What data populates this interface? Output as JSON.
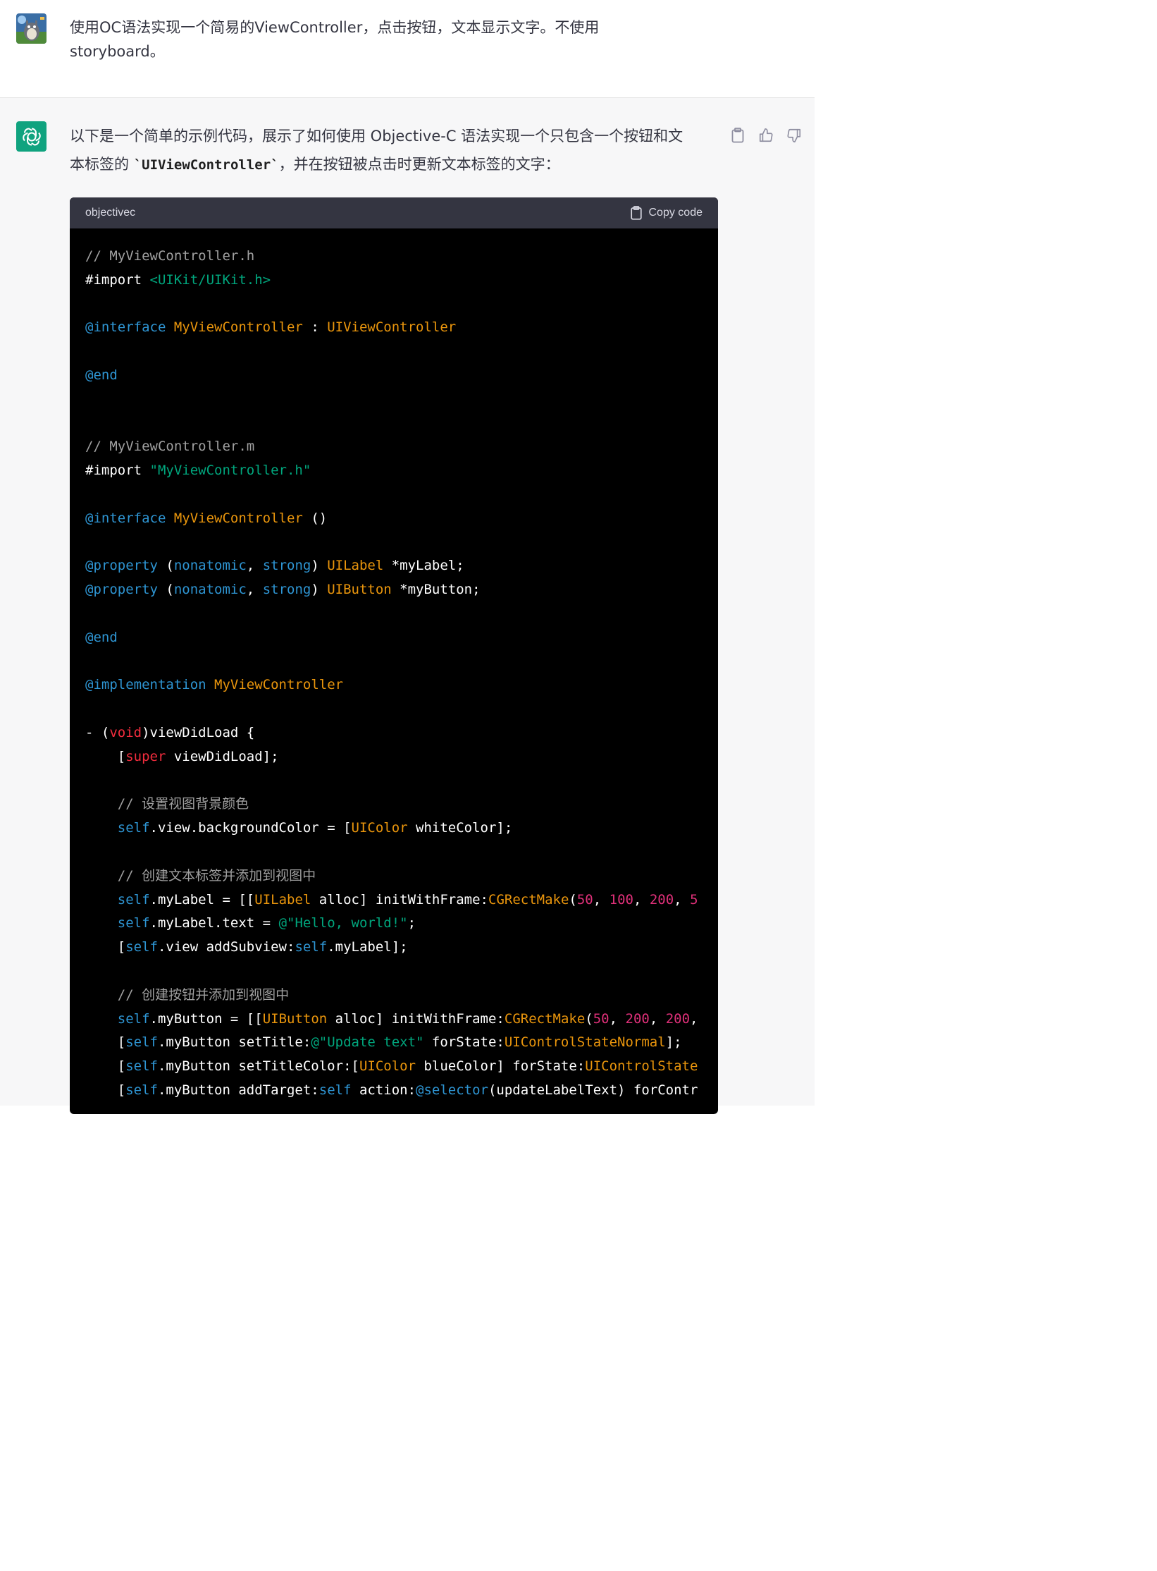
{
  "user": {
    "avatar": "totoro-avatar",
    "message_line1": "使用OC语法实现一个简易的ViewController，点击按钮，文本显示文字。不使用",
    "message_line2": "storyboard。"
  },
  "assistant": {
    "avatar": "openai-logo-icon",
    "intro_line1": "以下是一个简单的示例代码，展示了如何使用 Objective-C 语法实现一个只包含一个按钮和文",
    "intro_line2_before": "本标签的 ",
    "intro_code": "`UIViewController`",
    "intro_line2_after": "，并在按钮被点击时更新文本标签的文字：",
    "actions": [
      "clipboard-icon",
      "thumbs-up-icon",
      "thumbs-down-icon"
    ]
  },
  "code_block": {
    "language": "objectivec",
    "copy_label": "Copy code",
    "lines": [
      [
        {
          "t": "// MyViewController.h",
          "c": "c"
        }
      ],
      [
        {
          "t": "#import ",
          "c": ""
        },
        {
          "t": "<UIKit/UIKit.h>",
          "c": "s"
        }
      ],
      [],
      [
        {
          "t": "@interface",
          "c": "k"
        },
        {
          "t": " ",
          "c": ""
        },
        {
          "t": "MyViewController",
          "c": "ty"
        },
        {
          "t": " : ",
          "c": ""
        },
        {
          "t": "UIViewController",
          "c": "ty"
        }
      ],
      [],
      [
        {
          "t": "@end",
          "c": "k"
        }
      ],
      [],
      [],
      [
        {
          "t": "// MyViewController.m",
          "c": "c"
        }
      ],
      [
        {
          "t": "#import ",
          "c": ""
        },
        {
          "t": "\"MyViewController.h\"",
          "c": "s"
        }
      ],
      [],
      [
        {
          "t": "@interface",
          "c": "k"
        },
        {
          "t": " ",
          "c": ""
        },
        {
          "t": "MyViewController",
          "c": "ty"
        },
        {
          "t": " ()",
          "c": ""
        }
      ],
      [],
      [
        {
          "t": "@property",
          "c": "k"
        },
        {
          "t": " (",
          "c": ""
        },
        {
          "t": "nonatomic",
          "c": "k"
        },
        {
          "t": ", ",
          "c": ""
        },
        {
          "t": "strong",
          "c": "k"
        },
        {
          "t": ") ",
          "c": ""
        },
        {
          "t": "UILabel",
          "c": "ty"
        },
        {
          "t": " *myLabel;",
          "c": ""
        }
      ],
      [
        {
          "t": "@property",
          "c": "k"
        },
        {
          "t": " (",
          "c": ""
        },
        {
          "t": "nonatomic",
          "c": "k"
        },
        {
          "t": ", ",
          "c": ""
        },
        {
          "t": "strong",
          "c": "k"
        },
        {
          "t": ") ",
          "c": ""
        },
        {
          "t": "UIButton",
          "c": "ty"
        },
        {
          "t": " *myButton;",
          "c": ""
        }
      ],
      [],
      [
        {
          "t": "@end",
          "c": "k"
        }
      ],
      [],
      [
        {
          "t": "@implementation",
          "c": "k"
        },
        {
          "t": " ",
          "c": ""
        },
        {
          "t": "MyViewController",
          "c": "ty"
        }
      ],
      [],
      [
        {
          "t": "- (",
          "c": ""
        },
        {
          "t": "void",
          "c": "t"
        },
        {
          "t": ")viewDidLoad {",
          "c": ""
        }
      ],
      [
        {
          "t": "    [",
          "c": ""
        },
        {
          "t": "super",
          "c": "t"
        },
        {
          "t": " viewDidLoad];",
          "c": ""
        }
      ],
      [],
      [
        {
          "t": "    // 设置视图背景颜色",
          "c": "c"
        }
      ],
      [
        {
          "t": "    ",
          "c": ""
        },
        {
          "t": "self",
          "c": "k"
        },
        {
          "t": ".view.backgroundColor = [",
          "c": ""
        },
        {
          "t": "UIColor",
          "c": "ty"
        },
        {
          "t": " whiteColor];",
          "c": ""
        }
      ],
      [],
      [
        {
          "t": "    // 创建文本标签并添加到视图中",
          "c": "c"
        }
      ],
      [
        {
          "t": "    ",
          "c": ""
        },
        {
          "t": "self",
          "c": "k"
        },
        {
          "t": ".myLabel = [[",
          "c": ""
        },
        {
          "t": "UILabel",
          "c": "ty"
        },
        {
          "t": " alloc] initWithFrame:",
          "c": ""
        },
        {
          "t": "CGRectMake",
          "c": "ty"
        },
        {
          "t": "(",
          "c": ""
        },
        {
          "t": "50",
          "c": "n"
        },
        {
          "t": ", ",
          "c": ""
        },
        {
          "t": "100",
          "c": "n"
        },
        {
          "t": ", ",
          "c": ""
        },
        {
          "t": "200",
          "c": "n"
        },
        {
          "t": ", ",
          "c": ""
        },
        {
          "t": "5",
          "c": "n"
        }
      ],
      [
        {
          "t": "    ",
          "c": ""
        },
        {
          "t": "self",
          "c": "k"
        },
        {
          "t": ".myLabel.text = ",
          "c": ""
        },
        {
          "t": "@\"Hello, world!\"",
          "c": "s"
        },
        {
          "t": ";",
          "c": ""
        }
      ],
      [
        {
          "t": "    [",
          "c": ""
        },
        {
          "t": "self",
          "c": "k"
        },
        {
          "t": ".view addSubview:",
          "c": ""
        },
        {
          "t": "self",
          "c": "k"
        },
        {
          "t": ".myLabel];",
          "c": ""
        }
      ],
      [],
      [
        {
          "t": "    // 创建按钮并添加到视图中",
          "c": "c"
        }
      ],
      [
        {
          "t": "    ",
          "c": ""
        },
        {
          "t": "self",
          "c": "k"
        },
        {
          "t": ".myButton = [[",
          "c": ""
        },
        {
          "t": "UIButton",
          "c": "ty"
        },
        {
          "t": " alloc] initWithFrame:",
          "c": ""
        },
        {
          "t": "CGRectMake",
          "c": "ty"
        },
        {
          "t": "(",
          "c": ""
        },
        {
          "t": "50",
          "c": "n"
        },
        {
          "t": ", ",
          "c": ""
        },
        {
          "t": "200",
          "c": "n"
        },
        {
          "t": ", ",
          "c": ""
        },
        {
          "t": "200",
          "c": "n"
        },
        {
          "t": ",",
          "c": ""
        }
      ],
      [
        {
          "t": "    [",
          "c": ""
        },
        {
          "t": "self",
          "c": "k"
        },
        {
          "t": ".myButton setTitle:",
          "c": ""
        },
        {
          "t": "@\"Update text\"",
          "c": "s"
        },
        {
          "t": " forState:",
          "c": ""
        },
        {
          "t": "UIControlStateNormal",
          "c": "ty"
        },
        {
          "t": "];",
          "c": ""
        }
      ],
      [
        {
          "t": "    [",
          "c": ""
        },
        {
          "t": "self",
          "c": "k"
        },
        {
          "t": ".myButton setTitleColor:[",
          "c": ""
        },
        {
          "t": "UIColor",
          "c": "ty"
        },
        {
          "t": " blueColor] forState:",
          "c": ""
        },
        {
          "t": "UIControlState",
          "c": "ty"
        }
      ],
      [
        {
          "t": "    [",
          "c": ""
        },
        {
          "t": "self",
          "c": "k"
        },
        {
          "t": ".myButton addTarget:",
          "c": ""
        },
        {
          "t": "self",
          "c": "k"
        },
        {
          "t": " action:",
          "c": ""
        },
        {
          "t": "@selector",
          "c": "k"
        },
        {
          "t": "(updateLabelText) forContr",
          "c": ""
        }
      ]
    ]
  }
}
